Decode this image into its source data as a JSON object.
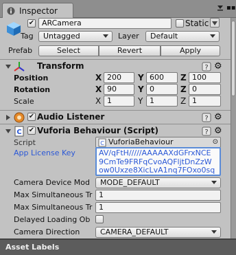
{
  "window": {
    "tab_title": "Inspector"
  },
  "header": {
    "name": "ARCamera",
    "static_label": "Static",
    "tag_label": "Tag",
    "tag_value": "Untagged",
    "layer_label": "Layer",
    "layer_value": "Default",
    "prefab_label": "Prefab",
    "prefab_buttons": [
      "Select",
      "Revert",
      "Apply"
    ]
  },
  "transform": {
    "title": "Transform",
    "rows": [
      {
        "label": "Position",
        "x": "200",
        "y": "600",
        "z": "100"
      },
      {
        "label": "Rotation",
        "x": "90",
        "y": "0",
        "z": "0"
      },
      {
        "label": "Scale",
        "x": "1",
        "y": "1",
        "z": "1"
      }
    ],
    "axes": [
      "X",
      "Y",
      "Z"
    ]
  },
  "audio": {
    "title": "Audio Listener"
  },
  "vuforia": {
    "title": "Vuforia Behaviour (Script)",
    "script_label": "Script",
    "script_value": "VuforiaBehaviour",
    "license_label": "App License Key",
    "license_lines": [
      "AV/qFtH/////AAAAAXdGFrxNCE",
      "9CmTe9FRFqCvoAQFljtDnZzW",
      "ow0Uxze8XicLvA1nq7FOxo0sq"
    ],
    "camera_device_label": "Camera Device Mod",
    "camera_device_value": "MODE_DEFAULT",
    "max_sim_1_label": "Max Simultaneous Tr",
    "max_sim_1_value": "1",
    "max_sim_2_label": "Max Simultaneous Tr",
    "max_sim_2_value": "1",
    "delayed_label": "Delayed Loading Ob",
    "camera_dir_label": "Camera Direction",
    "camera_dir_value": "CAMERA_DEFAULT"
  },
  "footer": {
    "asset_labels": "Asset Labels"
  },
  "colors": {
    "panel": "#c2c2c2",
    "link_blue": "#2b58d6",
    "footer": "#5c5c5c"
  }
}
